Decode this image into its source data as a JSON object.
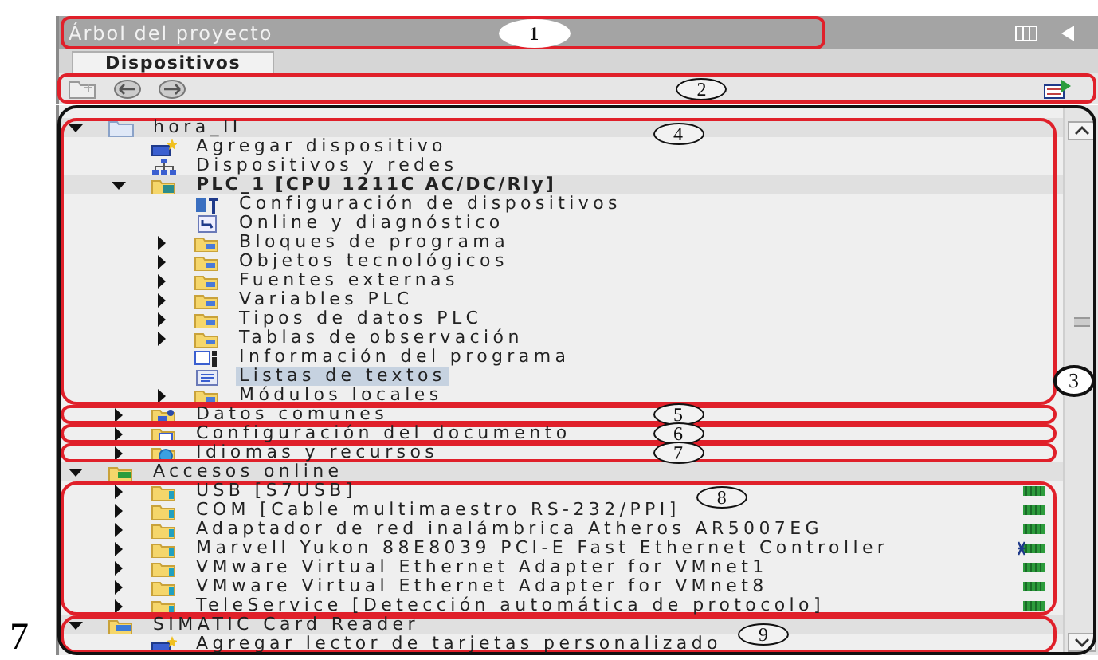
{
  "window": {
    "title": "Árbol del proyecto",
    "callout": "1"
  },
  "tabs": [
    {
      "label": "Dispositivos",
      "selected": true
    }
  ],
  "toolbar": {
    "callout": "2"
  },
  "tree": {
    "callout": "3",
    "nodes": [
      {
        "label": "hora_II",
        "kind": "project",
        "expanded": true,
        "selected": false,
        "callout": "4",
        "children": [
          {
            "label": "Agregar dispositivo",
            "kind": "add",
            "selected": false
          },
          {
            "label": "Dispositivos y redes",
            "kind": "network",
            "selected": false
          },
          {
            "label": "PLC_1 [CPU 1211C AC/DC/Rly]",
            "kind": "plc",
            "expanded": true,
            "selected": false,
            "emphasis": true,
            "children": [
              {
                "label": "Configuración de dispositivos",
                "kind": "config",
                "selected": false
              },
              {
                "label": "Online y diagnóstico",
                "kind": "online",
                "selected": false
              },
              {
                "label": "Bloques de programa",
                "kind": "folder",
                "expanded": false,
                "selected": false
              },
              {
                "label": "Objetos tecnológicos",
                "kind": "folder",
                "expanded": false,
                "selected": false
              },
              {
                "label": "Fuentes externas",
                "kind": "folder",
                "expanded": false,
                "selected": false
              },
              {
                "label": "Variables PLC",
                "kind": "folder",
                "expanded": false,
                "selected": false
              },
              {
                "label": "Tipos de datos PLC",
                "kind": "folder",
                "expanded": false,
                "selected": false
              },
              {
                "label": "Tablas de observación",
                "kind": "folder",
                "expanded": false,
                "selected": false
              },
              {
                "label": "Información del programa",
                "kind": "info",
                "selected": false
              },
              {
                "label": "Listas de textos",
                "kind": "list",
                "selected": true
              },
              {
                "label": "Módulos locales",
                "kind": "folder",
                "expanded": false,
                "selected": false
              }
            ]
          },
          {
            "label": "Datos comunes",
            "kind": "common",
            "expanded": false,
            "selected": false,
            "callout": "5"
          },
          {
            "label": "Configuración del documento",
            "kind": "docs",
            "expanded": false,
            "selected": false,
            "callout": "6"
          },
          {
            "label": "Idiomas y recursos",
            "kind": "languages",
            "expanded": false,
            "selected": false,
            "callout": "7",
            "outline_end": true
          }
        ]
      },
      {
        "label": "Accesos online",
        "kind": "access",
        "expanded": true,
        "selected": false,
        "children": [
          {
            "label": "USB [S7USB]",
            "kind": "interface",
            "expanded": false,
            "selected": false,
            "link_active": false,
            "callout": "8"
          },
          {
            "label": "COM [Cable multimaestro RS-232/PPI]",
            "kind": "interface",
            "expanded": false,
            "selected": false,
            "link_active": false
          },
          {
            "label": "Adaptador de red inalámbrica Atheros AR5007EG",
            "kind": "interface",
            "expanded": false,
            "selected": false,
            "link_active": false
          },
          {
            "label": "Marvell Yukon 88E8039 PCI-E Fast Ethernet Controller",
            "kind": "interface",
            "expanded": false,
            "selected": false,
            "link_active": true
          },
          {
            "label": "VMware Virtual Ethernet Adapter for VMnet1",
            "kind": "interface",
            "expanded": false,
            "selected": false,
            "link_active": false
          },
          {
            "label": "VMware Virtual Ethernet Adapter for VMnet8",
            "kind": "interface",
            "expanded": false,
            "selected": false,
            "link_active": false
          },
          {
            "label": "TeleService [Detección automática de protocolo]",
            "kind": "interface",
            "expanded": false,
            "selected": false,
            "link_active": false
          }
        ]
      },
      {
        "label": "SIMATIC Card Reader",
        "kind": "reader",
        "expanded": true,
        "selected": false,
        "callout": "9",
        "children": [
          {
            "label": "Agregar lector de tarjetas personalizado",
            "kind": "add",
            "selected": false
          }
        ]
      }
    ]
  },
  "page_number": "7"
}
